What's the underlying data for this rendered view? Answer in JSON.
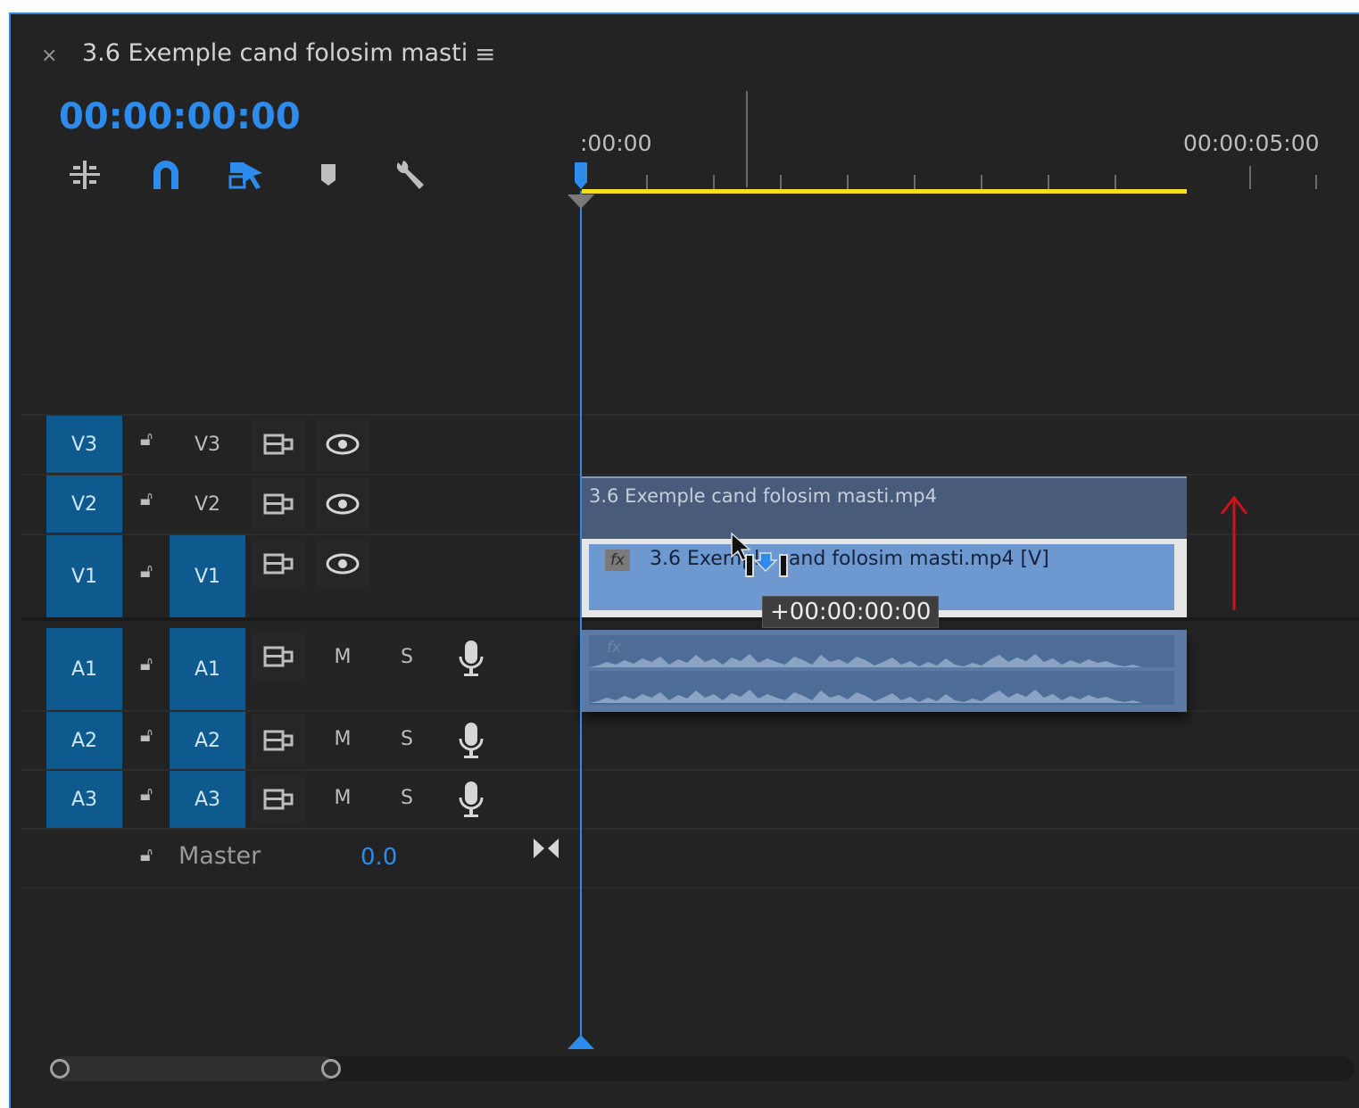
{
  "header": {
    "close_glyph": "×",
    "sequence_title": "3.6 Exemple cand folosim masti",
    "menu_glyph": "≡"
  },
  "timecode": "00:00:00:00",
  "ruler": {
    "start_label": ":00:00",
    "end_label": "00:00:05:00"
  },
  "tools": [
    {
      "name": "insert-nest-icon"
    },
    {
      "name": "snap-magnet-icon"
    },
    {
      "name": "linked-selection-icon"
    },
    {
      "name": "add-marker-icon"
    },
    {
      "name": "timeline-settings-wrench-icon"
    }
  ],
  "video_tracks": [
    {
      "source": "V3",
      "target": "V3",
      "target_active": false
    },
    {
      "source": "V2",
      "target": "V2",
      "target_active": false
    },
    {
      "source": "V1",
      "target": "V1",
      "target_active": true
    }
  ],
  "audio_tracks": [
    {
      "source": "A1",
      "target": "A1",
      "mute": "M",
      "solo": "S"
    },
    {
      "source": "A2",
      "target": "A2",
      "mute": "M",
      "solo": "S"
    },
    {
      "source": "A3",
      "target": "A3",
      "mute": "M",
      "solo": "S"
    }
  ],
  "master": {
    "label": "Master",
    "value": "0.0"
  },
  "clips": {
    "dragged_clip_label": "3.6 Exemple cand folosim masti.mp4",
    "video_clip_label": "3.6 Exemple cand folosim masti.mp4 [V]",
    "fx_badge": "fx"
  },
  "tooltip": "+00:00:00:00",
  "colors": {
    "accent_blue": "#2d8ceb",
    "track_target": "#0e5a8e",
    "work_area_yellow": "#f2e020",
    "annotation_red": "#d0121b"
  }
}
